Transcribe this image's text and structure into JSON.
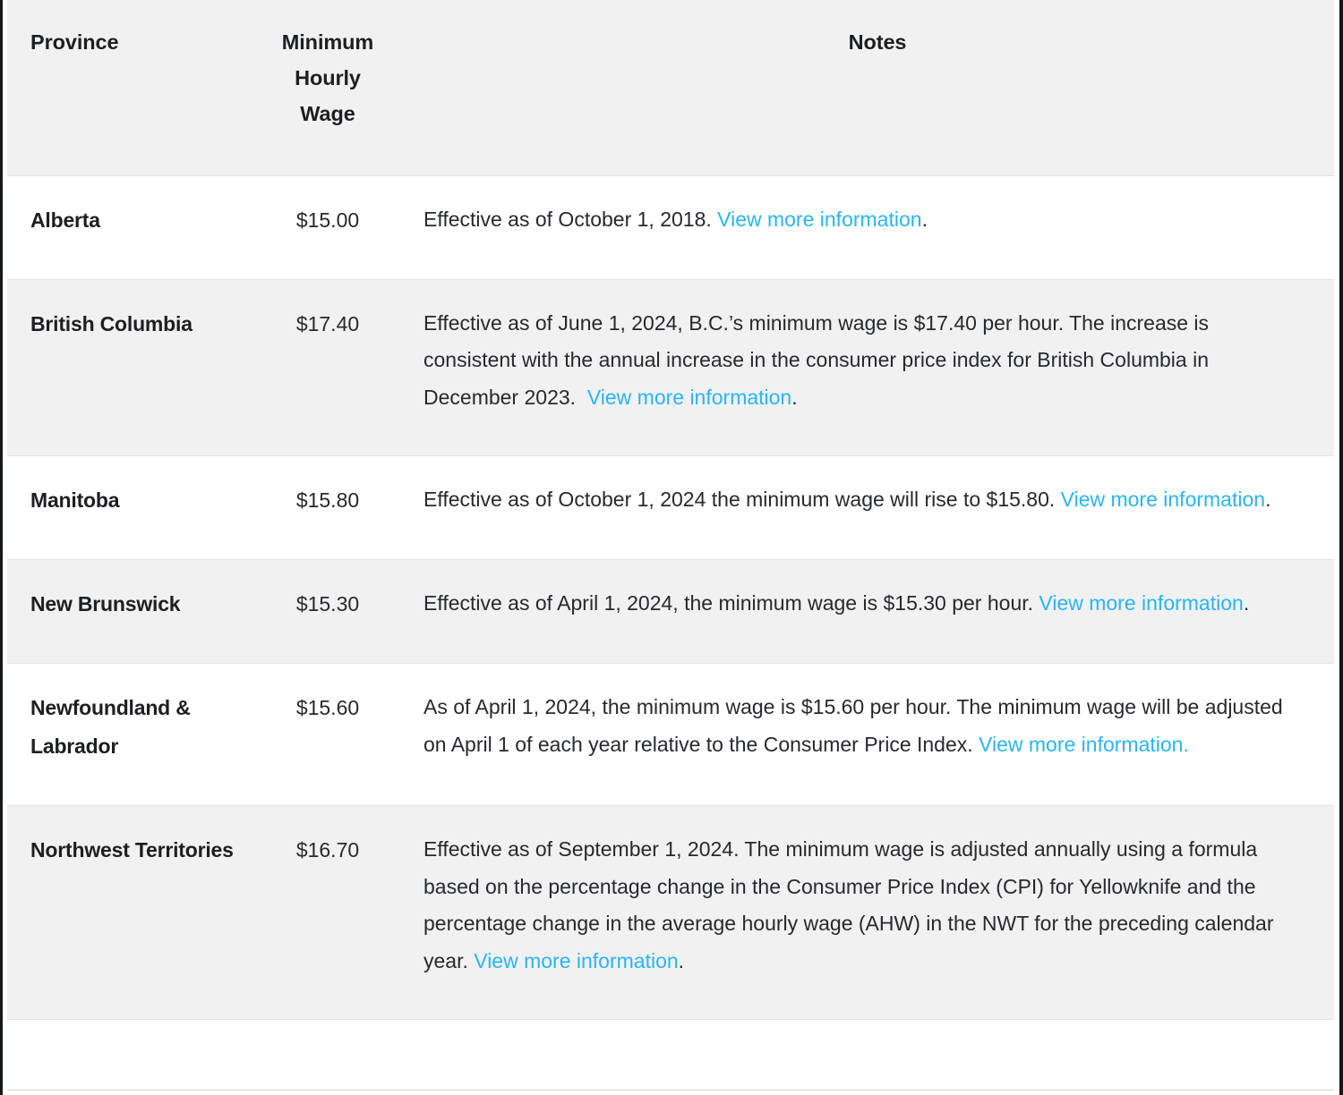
{
  "table": {
    "columns": [
      {
        "key": "province",
        "label": "Province",
        "align": "left"
      },
      {
        "key": "wage",
        "label": "Minimum Hourly Wage",
        "label_lines": [
          "Minimum",
          "Hourly",
          "Wage"
        ],
        "align": "center"
      },
      {
        "key": "notes",
        "label": "Notes",
        "align": "center"
      }
    ],
    "link_color": "#29b5f3",
    "header_background": "#f1f1f1",
    "alt_row_background": "#f1f1f1",
    "row_background": "#ffffff",
    "link_label": "View more information",
    "rows": [
      {
        "province": "Alberta",
        "wage": "$15.00",
        "shaded": false,
        "notes_parts": [
          {
            "type": "text",
            "value": "Effective as of October 1, 2018. "
          },
          {
            "type": "link",
            "value": "View more information"
          },
          {
            "type": "text",
            "value": "."
          }
        ]
      },
      {
        "province": "British Columbia",
        "wage": "$17.40",
        "shaded": true,
        "notes_parts": [
          {
            "type": "text",
            "value": "Effective as of June 1, 2024, B.C.’s minimum wage is $17.40 per hour. The increase is consistent with the annual increase in the consumer price index for British Columbia in December 2023.  "
          },
          {
            "type": "link",
            "value": "View more information"
          },
          {
            "type": "text",
            "value": "."
          }
        ]
      },
      {
        "province": "Manitoba",
        "wage": "$15.80",
        "shaded": false,
        "notes_parts": [
          {
            "type": "text",
            "value": "Effective as of October 1, 2024 the minimum wage will rise to $15.80. "
          },
          {
            "type": "link",
            "value": "View more information"
          },
          {
            "type": "text",
            "value": "."
          }
        ]
      },
      {
        "province": "New Brunswick",
        "wage": "$15.30",
        "shaded": true,
        "notes_parts": [
          {
            "type": "text",
            "value": "Effective as of April 1, 2024, the minimum wage is $15.30 per hour. "
          },
          {
            "type": "link",
            "value": "View more information"
          },
          {
            "type": "text",
            "value": "."
          }
        ]
      },
      {
        "province": "Newfoundland & Labrador",
        "wage": "$15.60",
        "shaded": false,
        "notes_parts": [
          {
            "type": "text",
            "value": "As of April 1, 2024, the minimum wage is $15.60 per hour. The minimum wage will be adjusted on April 1 of each year relative to the Consumer Price Index. "
          },
          {
            "type": "link",
            "value": "View more information."
          }
        ]
      },
      {
        "province": "Northwest Territories",
        "wage": "$16.70",
        "shaded": true,
        "notes_parts": [
          {
            "type": "text",
            "value": "Effective as of September 1, 2024. The minimum wage is adjusted annually using a formula based on the percentage change in the Consumer Price Index (CPI) for Yellowknife and the percentage change in the average hourly wage (AHW) in the NWT for the preceding calendar year. "
          },
          {
            "type": "link",
            "value": "View more information"
          },
          {
            "type": "text",
            "value": "."
          }
        ]
      }
    ]
  }
}
